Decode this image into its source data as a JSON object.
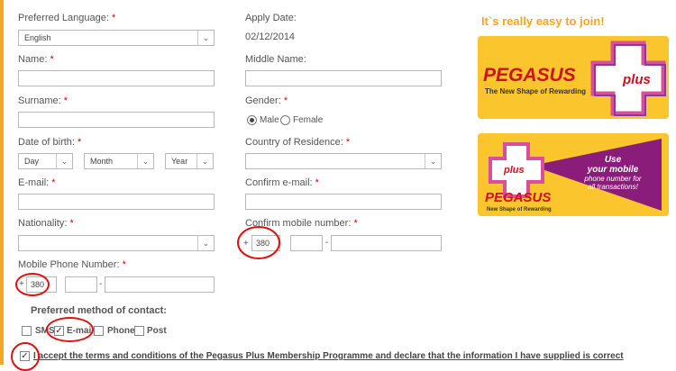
{
  "form": {
    "preferred_language": {
      "label": "Preferred Language:",
      "required": "*",
      "value": "English"
    },
    "apply_date": {
      "label": "Apply Date:",
      "value": "02/12/2014"
    },
    "name": {
      "label": "Name:",
      "required": "*",
      "value": ""
    },
    "middle_name": {
      "label": "Middle Name:",
      "value": ""
    },
    "surname": {
      "label": "Surname:",
      "required": "*",
      "value": ""
    },
    "gender": {
      "label": "Gender:",
      "required": "*",
      "options": [
        "Male",
        "Female"
      ],
      "selected": "Male"
    },
    "date_of_birth": {
      "label": "Date of birth:",
      "required": "*",
      "day": "Day",
      "month": "Month",
      "year": "Year"
    },
    "country_of_residence": {
      "label": "Country of Residence:",
      "required": "*",
      "value": ""
    },
    "email": {
      "label": "E-mail:",
      "required": "*",
      "value": ""
    },
    "confirm_email": {
      "label": "Confirm e-mail:",
      "required": "*",
      "value": ""
    },
    "nationality": {
      "label": "Nationality:",
      "required": "*",
      "value": ""
    },
    "confirm_mobile": {
      "label": "Confirm mobile number:",
      "required": "*",
      "prefix": "+",
      "code": "380",
      "dash": "-"
    },
    "mobile_phone": {
      "label": "Mobile Phone Number:",
      "required": "*",
      "prefix": "+",
      "code": "380",
      "dash": "-"
    },
    "contact": {
      "title": "Preferred method of contact:",
      "options": [
        {
          "label": "SMS",
          "checked": false
        },
        {
          "label": "E-mail",
          "checked": true
        },
        {
          "label": "Phone",
          "checked": false
        },
        {
          "label": "Post",
          "checked": false
        }
      ]
    },
    "terms": {
      "label": "I accept the terms and conditions of the Pegasus Plus Membership Programme and declare that the information I have supplied is correct",
      "checked": true
    }
  },
  "promo": {
    "title": "It`s really easy to join!",
    "banner1": {
      "brand": "PEGASUS",
      "tagline": "The New Shape of Rewarding",
      "badge": "plus"
    },
    "banner2": {
      "brand": "PEGASUS",
      "tagline": "New Shape of Rewarding",
      "badge": "plus",
      "callout_line1": "Use",
      "callout_line2": "your mobile",
      "callout_line3": "phone number for",
      "callout_line4": "all transactions!"
    }
  },
  "colors": {
    "accent": "#f5a623",
    "required": "#d0021b",
    "highlight_ring": "#e01010",
    "banner_yellow": "#fbc52d",
    "brand_red": "#d0111b",
    "brand_purple": "#8b1d7a"
  },
  "icons": {
    "dropdown_arrow": "chevron-down-icon",
    "checkmark": "check-icon"
  }
}
